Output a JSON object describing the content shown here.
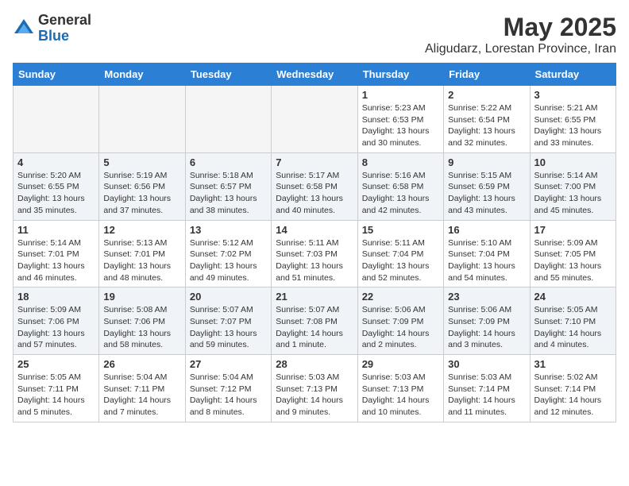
{
  "logo": {
    "general": "General",
    "blue": "Blue"
  },
  "title": "May 2025",
  "subtitle": "Aligudarz, Lorestan Province, Iran",
  "weekdays": [
    "Sunday",
    "Monday",
    "Tuesday",
    "Wednesday",
    "Thursday",
    "Friday",
    "Saturday"
  ],
  "weeks": [
    [
      {
        "day": "",
        "info": ""
      },
      {
        "day": "",
        "info": ""
      },
      {
        "day": "",
        "info": ""
      },
      {
        "day": "",
        "info": ""
      },
      {
        "day": "1",
        "info": "Sunrise: 5:23 AM\nSunset: 6:53 PM\nDaylight: 13 hours\nand 30 minutes."
      },
      {
        "day": "2",
        "info": "Sunrise: 5:22 AM\nSunset: 6:54 PM\nDaylight: 13 hours\nand 32 minutes."
      },
      {
        "day": "3",
        "info": "Sunrise: 5:21 AM\nSunset: 6:55 PM\nDaylight: 13 hours\nand 33 minutes."
      }
    ],
    [
      {
        "day": "4",
        "info": "Sunrise: 5:20 AM\nSunset: 6:55 PM\nDaylight: 13 hours\nand 35 minutes."
      },
      {
        "day": "5",
        "info": "Sunrise: 5:19 AM\nSunset: 6:56 PM\nDaylight: 13 hours\nand 37 minutes."
      },
      {
        "day": "6",
        "info": "Sunrise: 5:18 AM\nSunset: 6:57 PM\nDaylight: 13 hours\nand 38 minutes."
      },
      {
        "day": "7",
        "info": "Sunrise: 5:17 AM\nSunset: 6:58 PM\nDaylight: 13 hours\nand 40 minutes."
      },
      {
        "day": "8",
        "info": "Sunrise: 5:16 AM\nSunset: 6:58 PM\nDaylight: 13 hours\nand 42 minutes."
      },
      {
        "day": "9",
        "info": "Sunrise: 5:15 AM\nSunset: 6:59 PM\nDaylight: 13 hours\nand 43 minutes."
      },
      {
        "day": "10",
        "info": "Sunrise: 5:14 AM\nSunset: 7:00 PM\nDaylight: 13 hours\nand 45 minutes."
      }
    ],
    [
      {
        "day": "11",
        "info": "Sunrise: 5:14 AM\nSunset: 7:01 PM\nDaylight: 13 hours\nand 46 minutes."
      },
      {
        "day": "12",
        "info": "Sunrise: 5:13 AM\nSunset: 7:01 PM\nDaylight: 13 hours\nand 48 minutes."
      },
      {
        "day": "13",
        "info": "Sunrise: 5:12 AM\nSunset: 7:02 PM\nDaylight: 13 hours\nand 49 minutes."
      },
      {
        "day": "14",
        "info": "Sunrise: 5:11 AM\nSunset: 7:03 PM\nDaylight: 13 hours\nand 51 minutes."
      },
      {
        "day": "15",
        "info": "Sunrise: 5:11 AM\nSunset: 7:04 PM\nDaylight: 13 hours\nand 52 minutes."
      },
      {
        "day": "16",
        "info": "Sunrise: 5:10 AM\nSunset: 7:04 PM\nDaylight: 13 hours\nand 54 minutes."
      },
      {
        "day": "17",
        "info": "Sunrise: 5:09 AM\nSunset: 7:05 PM\nDaylight: 13 hours\nand 55 minutes."
      }
    ],
    [
      {
        "day": "18",
        "info": "Sunrise: 5:09 AM\nSunset: 7:06 PM\nDaylight: 13 hours\nand 57 minutes."
      },
      {
        "day": "19",
        "info": "Sunrise: 5:08 AM\nSunset: 7:06 PM\nDaylight: 13 hours\nand 58 minutes."
      },
      {
        "day": "20",
        "info": "Sunrise: 5:07 AM\nSunset: 7:07 PM\nDaylight: 13 hours\nand 59 minutes."
      },
      {
        "day": "21",
        "info": "Sunrise: 5:07 AM\nSunset: 7:08 PM\nDaylight: 14 hours\nand 1 minute."
      },
      {
        "day": "22",
        "info": "Sunrise: 5:06 AM\nSunset: 7:09 PM\nDaylight: 14 hours\nand 2 minutes."
      },
      {
        "day": "23",
        "info": "Sunrise: 5:06 AM\nSunset: 7:09 PM\nDaylight: 14 hours\nand 3 minutes."
      },
      {
        "day": "24",
        "info": "Sunrise: 5:05 AM\nSunset: 7:10 PM\nDaylight: 14 hours\nand 4 minutes."
      }
    ],
    [
      {
        "day": "25",
        "info": "Sunrise: 5:05 AM\nSunset: 7:11 PM\nDaylight: 14 hours\nand 5 minutes."
      },
      {
        "day": "26",
        "info": "Sunrise: 5:04 AM\nSunset: 7:11 PM\nDaylight: 14 hours\nand 7 minutes."
      },
      {
        "day": "27",
        "info": "Sunrise: 5:04 AM\nSunset: 7:12 PM\nDaylight: 14 hours\nand 8 minutes."
      },
      {
        "day": "28",
        "info": "Sunrise: 5:03 AM\nSunset: 7:13 PM\nDaylight: 14 hours\nand 9 minutes."
      },
      {
        "day": "29",
        "info": "Sunrise: 5:03 AM\nSunset: 7:13 PM\nDaylight: 14 hours\nand 10 minutes."
      },
      {
        "day": "30",
        "info": "Sunrise: 5:03 AM\nSunset: 7:14 PM\nDaylight: 14 hours\nand 11 minutes."
      },
      {
        "day": "31",
        "info": "Sunrise: 5:02 AM\nSunset: 7:14 PM\nDaylight: 14 hours\nand 12 minutes."
      }
    ]
  ]
}
